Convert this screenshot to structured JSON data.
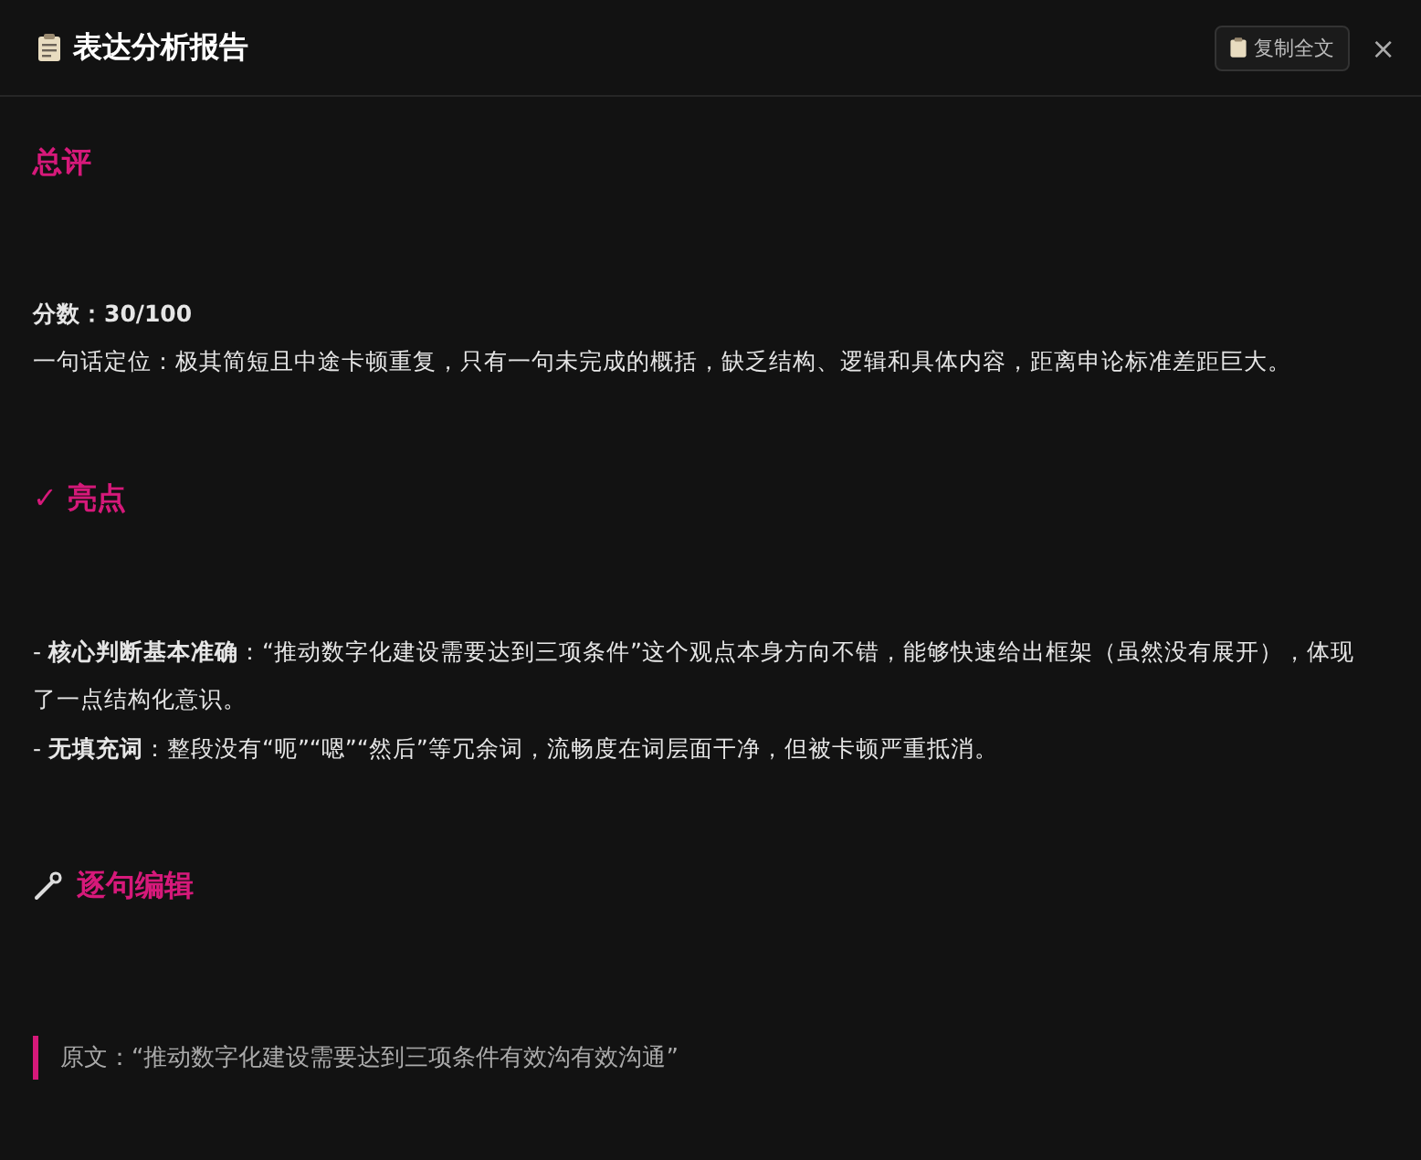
{
  "header": {
    "title": "表达分析报告",
    "copy_button": "复制全文",
    "close": "×"
  },
  "sections": [
    {
      "heading": "总评",
      "kind": "plain",
      "blocks": [
        {
          "kind": "score",
          "text": "分数：30/100"
        },
        {
          "kind": "para",
          "text": "一句话定位：极其简短且中途卡顿重复，只有一句未完成的概括，缺乏结构、逻辑和具体内容，距离申论标准差距巨大。"
        }
      ]
    },
    {
      "heading": "✓ 亮点",
      "kind": "plain",
      "blocks": [
        {
          "kind": "bullets",
          "items": [
            "- **核心判断基本准确**：“推动数字化建设需要达到三项条件”这个观点本身方向不错，能够快速给出框架（虽然没有展开），体现了一点结构化意识。",
            "- **无填充词**：整段没有“呃”“嗯”“然后”等冗余词，流畅度在词层面干净，但被卡顿严重抵消。"
          ]
        }
      ]
    },
    {
      "heading": "逐句编辑",
      "kind": "tool",
      "blocks": [
        {
          "kind": "quote",
          "text": "原文：“推动数字化建设需要达到三项条件有效沟有效沟通”"
        }
      ]
    }
  ]
}
